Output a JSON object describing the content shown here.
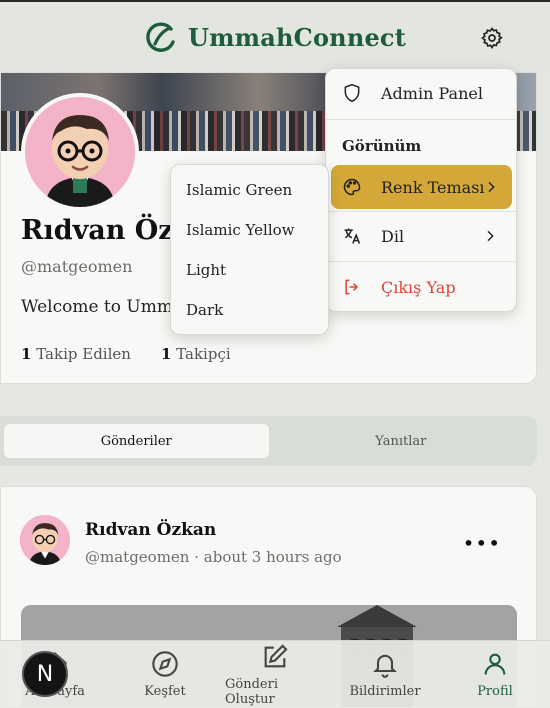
{
  "header": {
    "brand": "UmmahConnect",
    "settings_icon": "gear-icon",
    "brand_color": "#1f5c3e"
  },
  "profile": {
    "name": "Rıdvan Özkan",
    "handle": "@matgeomen",
    "bio": "Welcome to UmmahConnect!",
    "following_count": "1",
    "following_label": "Takip Edilen",
    "followers_count": "1",
    "followers_label": "Takipçi"
  },
  "tabs": [
    {
      "label": "Gönderiler",
      "active": true
    },
    {
      "label": "Yanıtlar",
      "active": false
    }
  ],
  "post": {
    "author": "Rıdvan Özkan",
    "meta": "@matgeomen · about 3 hours ago",
    "more_icon": "more-horizontal-icon"
  },
  "bottom_nav": [
    {
      "label": "Anasayfa",
      "icon": "home-icon"
    },
    {
      "label": "Keşfet",
      "icon": "compass-icon"
    },
    {
      "label": "Gönderi Oluştur",
      "icon": "edit-icon"
    },
    {
      "label": "Bildirimler",
      "icon": "bell-icon"
    },
    {
      "label": "Profil",
      "icon": "user-icon",
      "active": true
    }
  ],
  "fab": {
    "letter": "N"
  },
  "settings_menu": {
    "admin_panel": "Admin Panel",
    "appearance_heading": "Görünüm",
    "color_theme": "Renk Teması",
    "language": "Dil",
    "logout": "Çıkış Yap",
    "highlight_color": "#d4a838",
    "danger_color": "#d9463a"
  },
  "theme_menu": {
    "options": [
      "Islamic Green",
      "Islamic Yellow",
      "Light",
      "Dark"
    ]
  }
}
